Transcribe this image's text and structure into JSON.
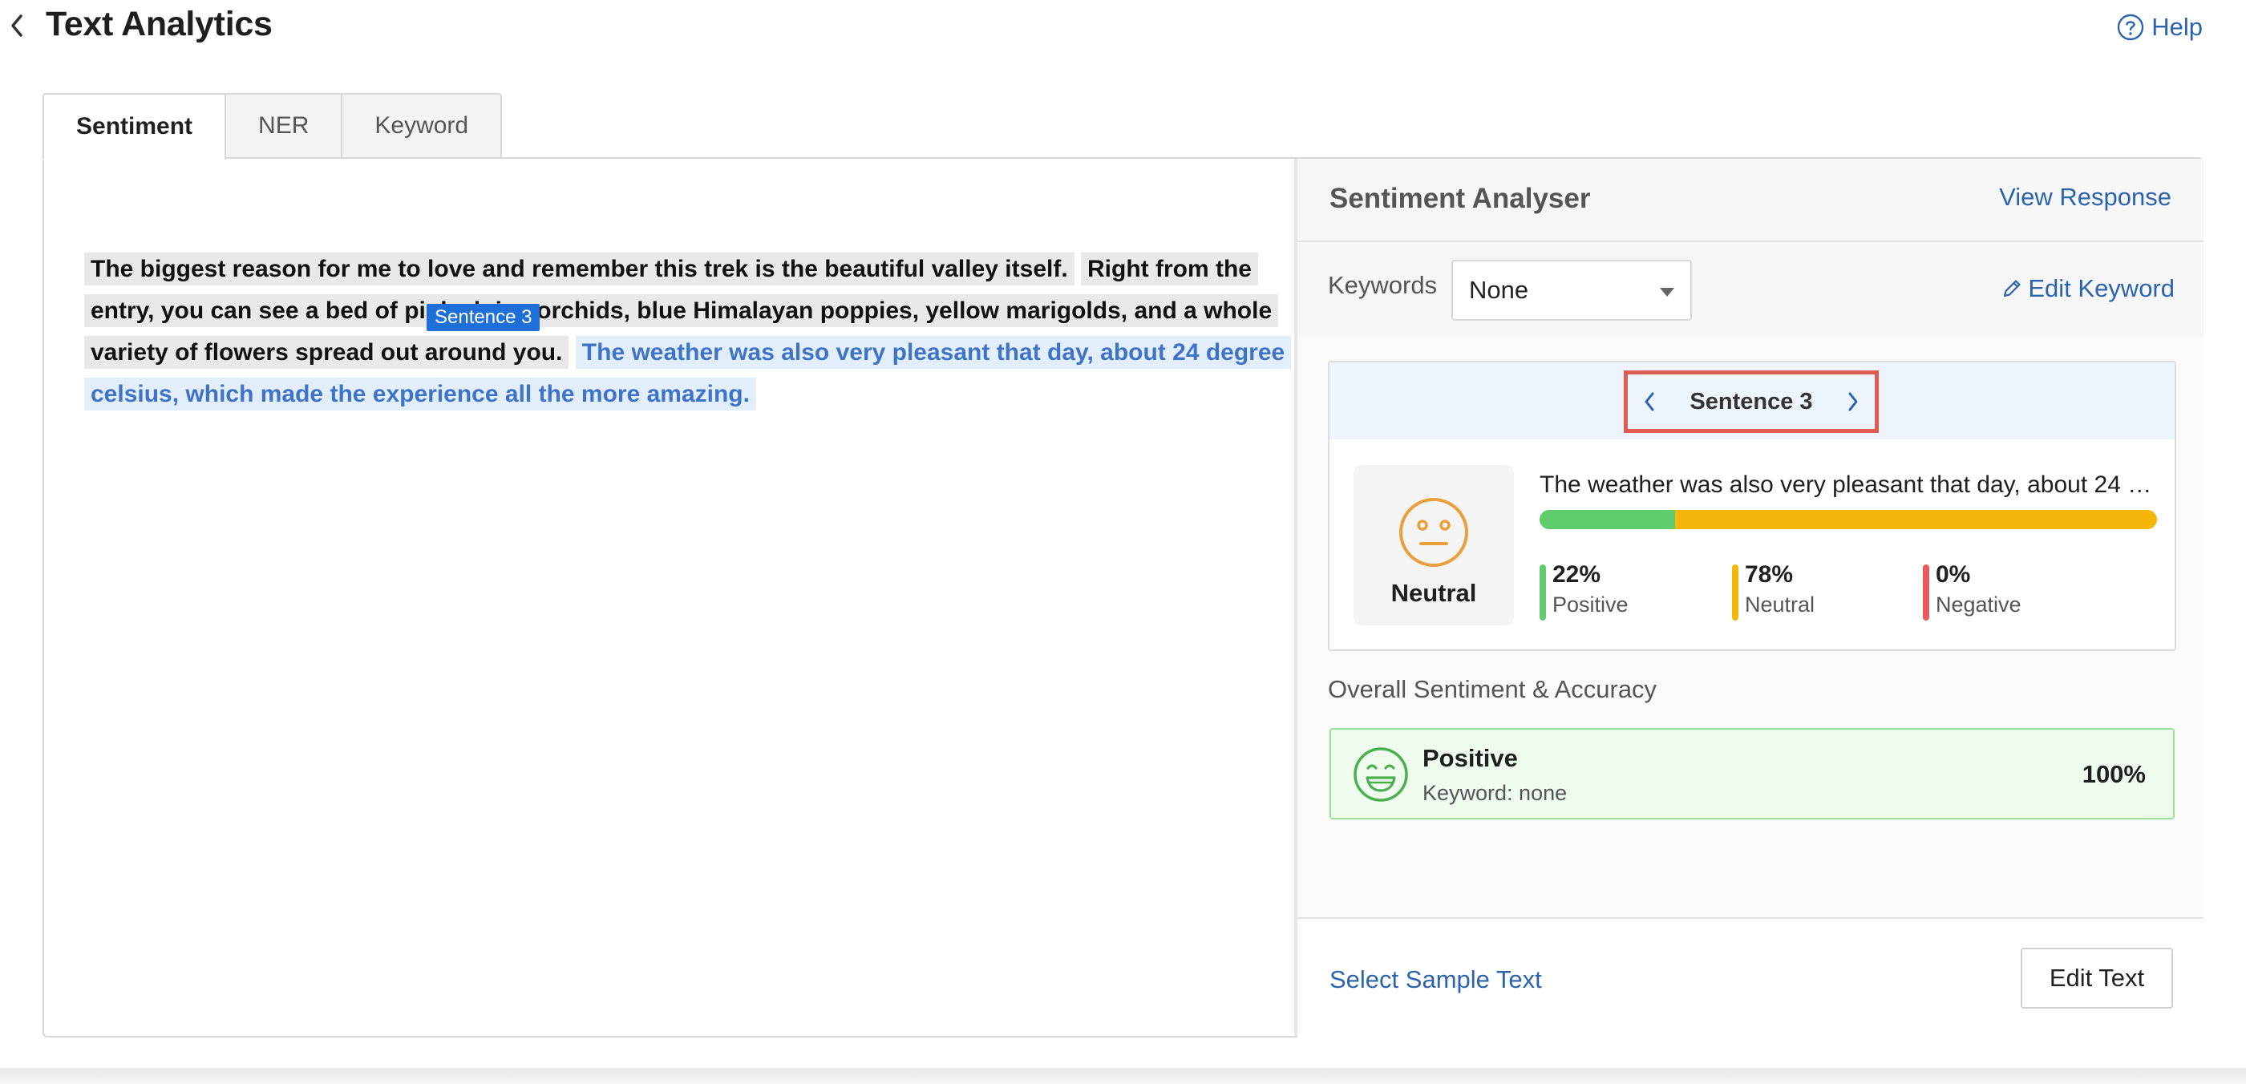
{
  "header": {
    "title": "Text Analytics",
    "help_label": "Help"
  },
  "tabs": [
    {
      "label": "Sentiment",
      "active": true
    },
    {
      "label": "NER",
      "active": false
    },
    {
      "label": "Keyword",
      "active": false
    }
  ],
  "text_panel": {
    "sentences": [
      "The biggest reason for me to love and remember this trek is the beautiful valley itself.",
      "Right from the entry, you can see a bed of pink alpine orchids, blue Himalayan poppies, yellow marigolds, and a whole variety of flowers spread out around you.",
      "The weather was also very pleasant that day, about 24 degree celsius, which made the experience all the more amazing."
    ],
    "selected_tag": "Sentence 3"
  },
  "analyser": {
    "title": "Sentiment Analyser",
    "view_response": "View Response",
    "keywords_label": "Keywords",
    "keyword_selected": "None",
    "edit_keyword": "Edit Keyword",
    "sentence_nav_label": "Sentence 3",
    "sentence_text": "The weather was also very pleasant that day, about 24 degree celsius, which made the experience all the more amazing.",
    "sentiment_label": "Neutral",
    "distribution": {
      "positive": 22,
      "neutral": 78,
      "negative": 0
    },
    "stats": [
      {
        "value": "22%",
        "label": "Positive",
        "color": "#5fcd6d"
      },
      {
        "value": "78%",
        "label": "Neutral",
        "color": "#f5b50b"
      },
      {
        "value": "0%",
        "label": "Negative",
        "color": "#ea5a5a"
      }
    ],
    "overall_title": "Overall Sentiment & Accuracy",
    "overall": {
      "label": "Positive",
      "keyword": "Keyword: none",
      "accuracy": "100%"
    },
    "select_sample": "Select Sample Text",
    "edit_text": "Edit Text"
  },
  "colors": {
    "link": "#2c63ad",
    "highlight_border": "#e15b55",
    "tag": "#1f6fd8"
  }
}
